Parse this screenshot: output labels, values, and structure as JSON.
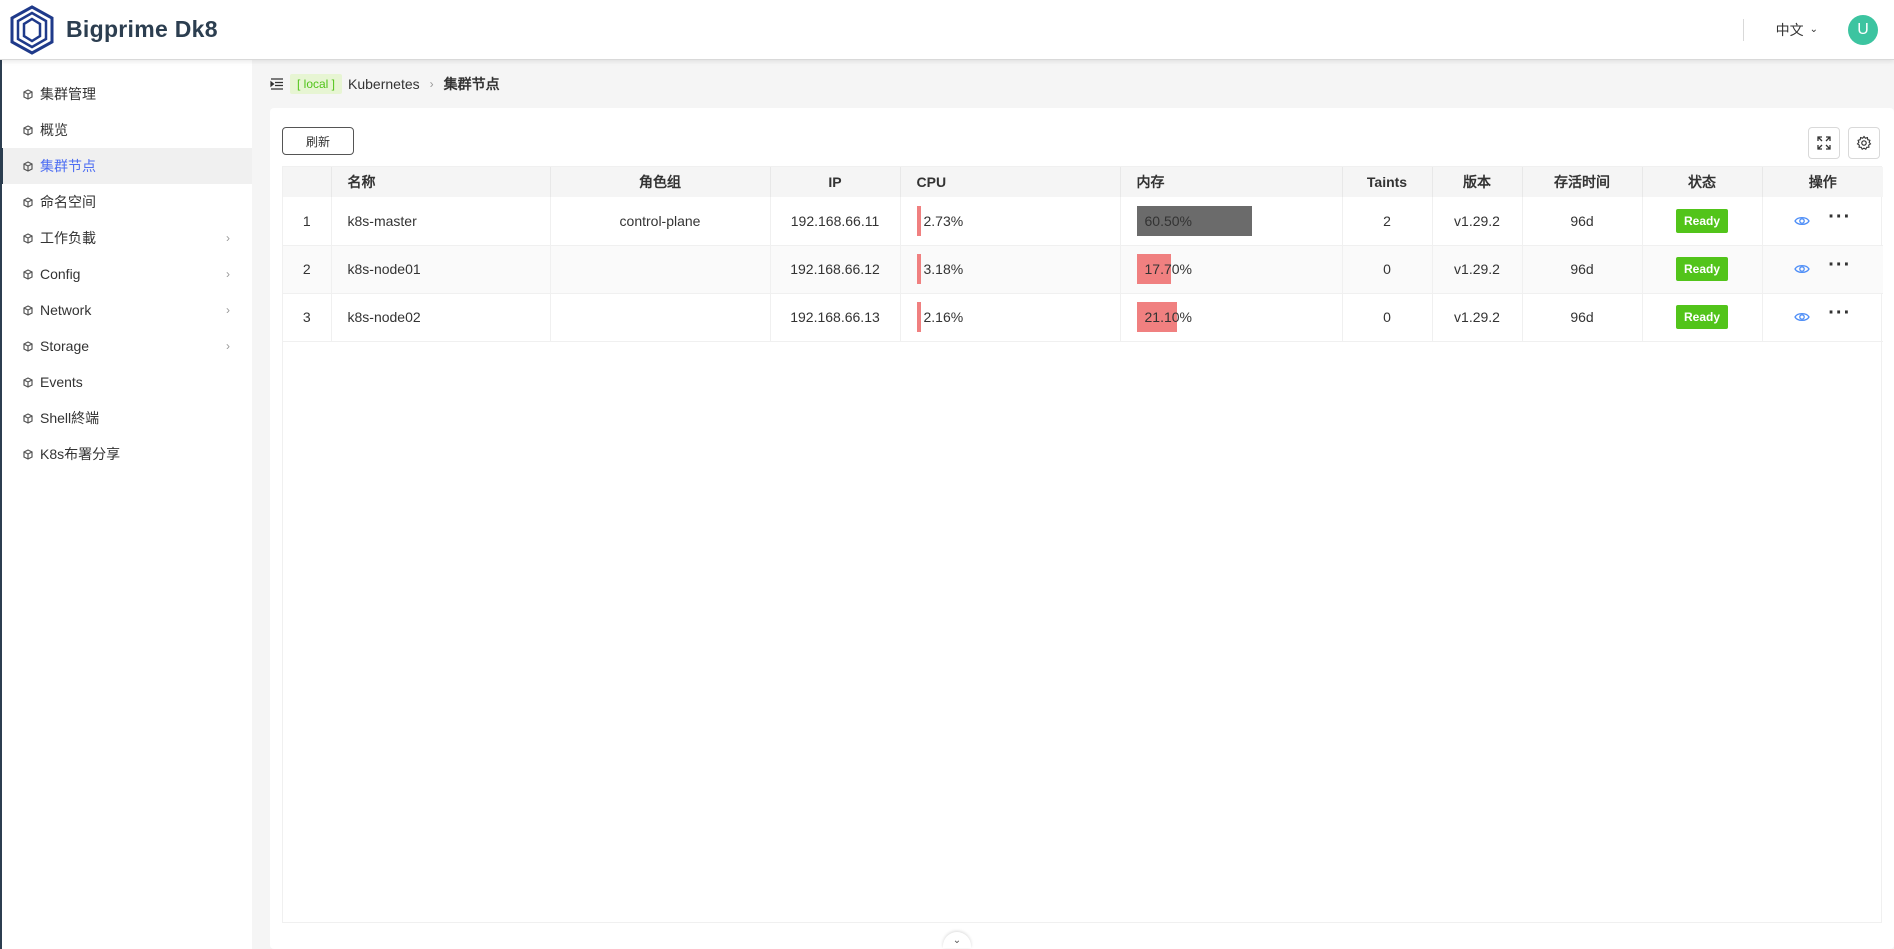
{
  "header": {
    "brand": "Bigprime Dk8",
    "language": "中文",
    "avatar_initial": "U",
    "avatar_color": "#3cc4a0"
  },
  "sidebar": {
    "items": [
      {
        "label": "集群管理",
        "icon": "cube-icon",
        "has_arrow": false,
        "active": false
      },
      {
        "label": "概览",
        "icon": "cube-icon",
        "has_arrow": false,
        "active": false
      },
      {
        "label": "集群节点",
        "icon": "cube-icon",
        "has_arrow": false,
        "active": true
      },
      {
        "label": "命名空间",
        "icon": "cube-icon",
        "has_arrow": false,
        "active": false
      },
      {
        "label": "工作负載",
        "icon": "cube-icon",
        "has_arrow": true,
        "active": false
      },
      {
        "label": "Config",
        "icon": "cube-icon",
        "has_arrow": true,
        "active": false
      },
      {
        "label": "Network",
        "icon": "cube-icon",
        "has_arrow": true,
        "active": false
      },
      {
        "label": "Storage",
        "icon": "cube-icon",
        "has_arrow": true,
        "active": false
      },
      {
        "label": "Events",
        "icon": "cube-icon",
        "has_arrow": false,
        "active": false
      },
      {
        "label": "Shell終端",
        "icon": "cube-icon",
        "has_arrow": false,
        "active": false
      },
      {
        "label": "K8s布署分享",
        "icon": "cube-icon",
        "has_arrow": false,
        "active": false
      }
    ],
    "active_color": "#4e6ef2"
  },
  "breadcrumb": {
    "tag": "[ local ]",
    "parent": "Kubernetes",
    "current": "集群节点"
  },
  "toolbar": {
    "refresh_label": "刷新"
  },
  "table": {
    "columns": [
      "",
      "名称",
      "角色组",
      "IP",
      "CPU",
      "内存",
      "Taints",
      "版本",
      "存活时间",
      "状态",
      "操作"
    ],
    "rows": [
      {
        "index": "1",
        "name": "k8s-master",
        "role": "control-plane",
        "ip": "192.168.66.11",
        "cpu": "2.73%",
        "memory": "60.50%",
        "memory_fraction": 0.605,
        "memory_color": "#6b6b6b",
        "taints": "2",
        "version": "v1.29.2",
        "age": "96d",
        "status": "Ready"
      },
      {
        "index": "2",
        "name": "k8s-node01",
        "role": "",
        "ip": "192.168.66.12",
        "cpu": "3.18%",
        "memory": "17.70%",
        "memory_fraction": 0.177,
        "memory_color": "#f08080",
        "taints": "0",
        "version": "v1.29.2",
        "age": "96d",
        "status": "Ready"
      },
      {
        "index": "3",
        "name": "k8s-node02",
        "role": "",
        "ip": "192.168.66.13",
        "cpu": "2.16%",
        "memory": "21.10%",
        "memory_fraction": 0.211,
        "memory_color": "#f08080",
        "taints": "0",
        "version": "v1.29.2",
        "age": "96d",
        "status": "Ready"
      }
    ],
    "status_color": "#52c41a",
    "cpu_bar_color": "#f08080"
  }
}
